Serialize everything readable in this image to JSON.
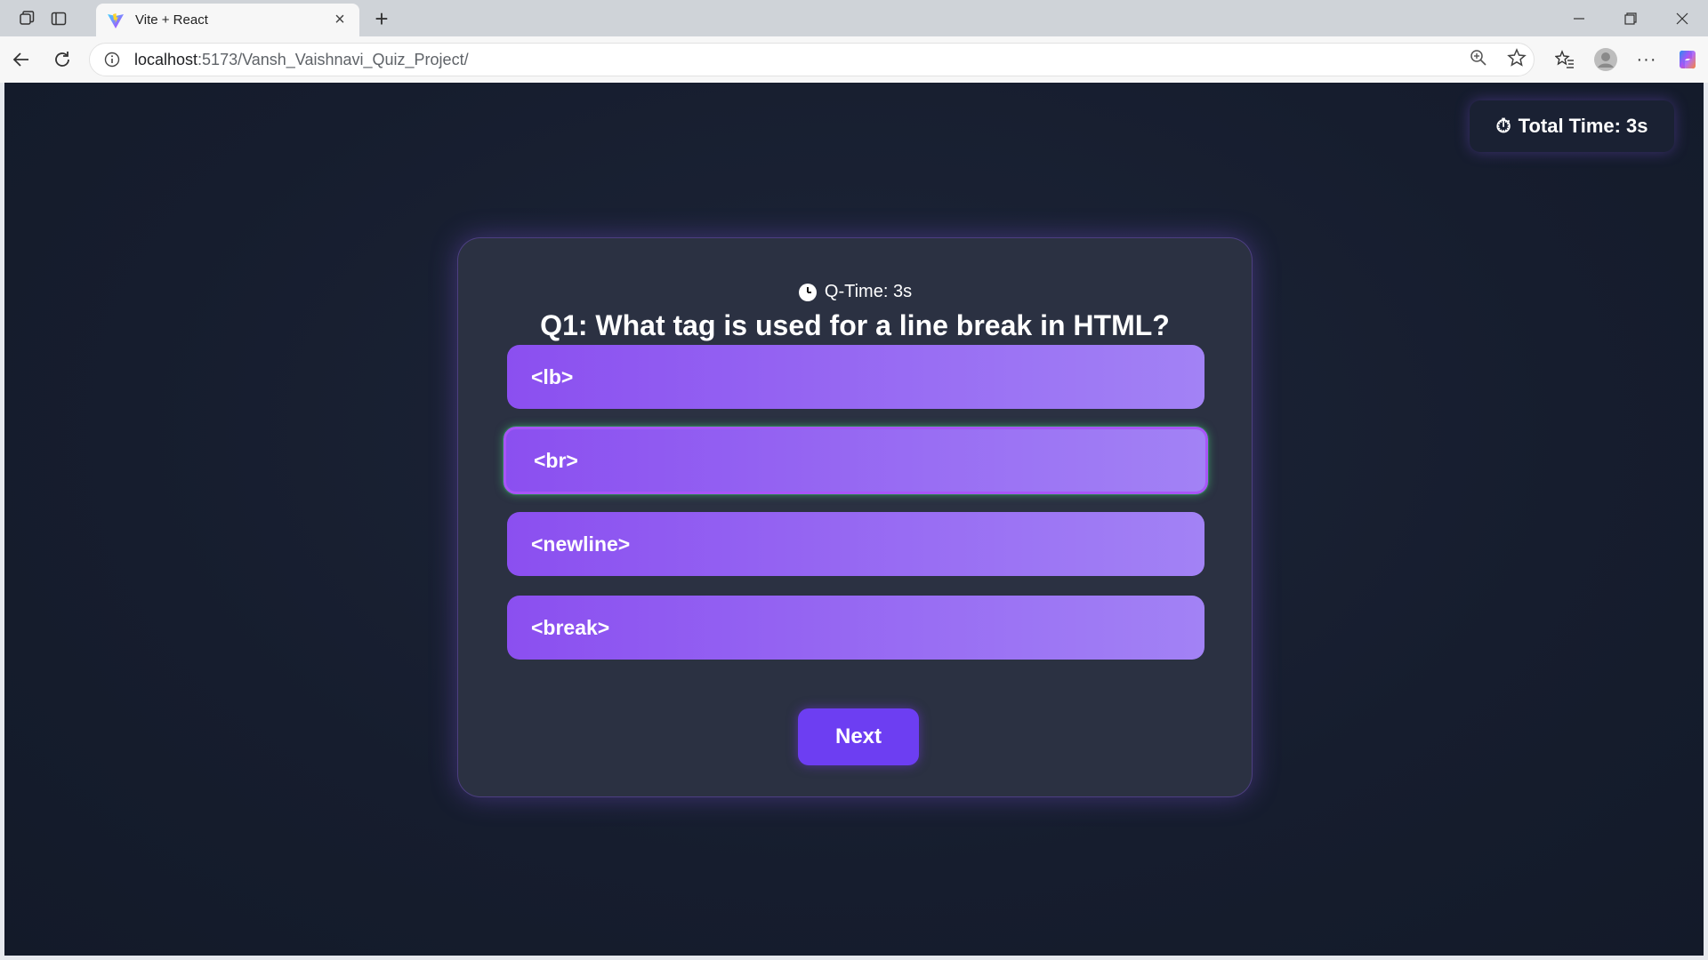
{
  "browser": {
    "tab_title": "Vite + React",
    "url_host": "localhost",
    "url_rest": ":5173/Vansh_Vaishnavi_Quiz_Project/",
    "icons": [
      "workspaces-icon",
      "tab-actions-icon",
      "vite-favicon",
      "close-tab-icon",
      "new-tab-icon",
      "minimize-icon",
      "restore-icon",
      "close-window-icon",
      "back-icon",
      "refresh-icon",
      "site-info-icon",
      "zoom-icon",
      "favorite-star-icon",
      "favorites-icon",
      "profile-icon",
      "more-icon",
      "copilot-icon"
    ]
  },
  "quiz": {
    "total_time_icon": "⏱",
    "total_time": "Total Time: 3s",
    "qtime_label": "Q-Time: 3s",
    "question": "Q1: What tag is used for a line break in HTML?",
    "options": [
      "<lb>",
      "<br>",
      "<newline>",
      "<break>"
    ],
    "selected_index": 1,
    "next_label": "Next"
  },
  "colors": {
    "background": "#161d2e",
    "card": "#2b3142",
    "option_start": "#8b4ff0",
    "option_end": "#a282f5",
    "accent": "#6d3ef2",
    "selected_glow": "#4ade80"
  }
}
